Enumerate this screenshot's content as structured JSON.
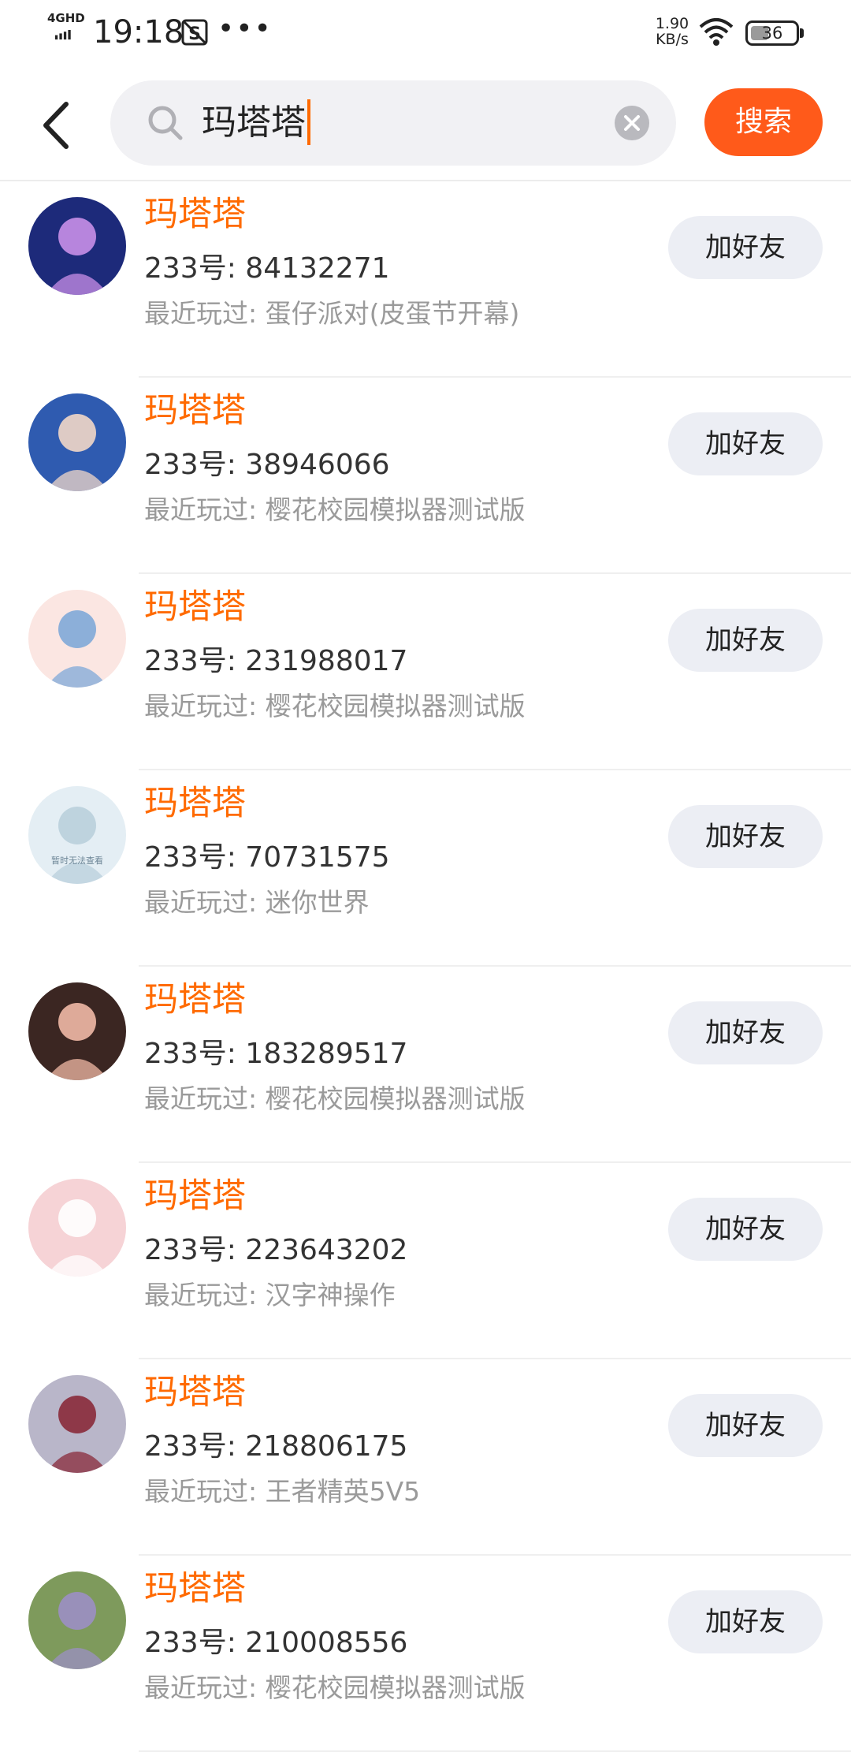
{
  "status_bar": {
    "network": "4GHD",
    "time": "19:18",
    "dots": "•••",
    "speed_value": "1.90",
    "speed_unit": "KB/s",
    "battery": "36"
  },
  "search": {
    "query": "玛塔塔",
    "button_label": "搜索"
  },
  "results": [
    {
      "name": "玛塔塔",
      "uid_prefix": "233号: ",
      "uid": "84132271",
      "recent_prefix": "最近玩过: ",
      "recent": "蛋仔派对(皮蛋节开幕)",
      "button": "加好友",
      "avatar_colors": [
        "#1d2a7a",
        "#c98fe8"
      ]
    },
    {
      "name": "玛塔塔",
      "uid_prefix": "233号: ",
      "uid": "38946066",
      "recent_prefix": "最近玩过: ",
      "recent": "樱花校园模拟器测试版",
      "button": "加好友",
      "avatar_colors": [
        "#2f5bb0",
        "#f2d7c8"
      ]
    },
    {
      "name": "玛塔塔",
      "uid_prefix": "233号: ",
      "uid": "231988017",
      "recent_prefix": "最近玩过: ",
      "recent": "樱花校园模拟器测试版",
      "button": "加好友",
      "avatar_colors": [
        "#fbe6e2",
        "#7fa8d8"
      ]
    },
    {
      "name": "玛塔塔",
      "uid_prefix": "233号: ",
      "uid": "70731575",
      "recent_prefix": "最近玩过: ",
      "recent": "迷你世界",
      "button": "加好友",
      "avatar_colors": [
        "#e4eef4",
        "#b9cfdc"
      ],
      "avatar_caption": "暂时无法查看"
    },
    {
      "name": "玛塔塔",
      "uid_prefix": "233号: ",
      "uid": "183289517",
      "recent_prefix": "最近玩过: ",
      "recent": "樱花校园模拟器测试版",
      "button": "加好友",
      "avatar_colors": [
        "#3b2622",
        "#f1b9a6"
      ]
    },
    {
      "name": "玛塔塔",
      "uid_prefix": "233号: ",
      "uid": "223643202",
      "recent_prefix": "最近玩过: ",
      "recent": "汉字神操作",
      "button": "加好友",
      "avatar_colors": [
        "#f6d3d6",
        "#ffffff"
      ]
    },
    {
      "name": "玛塔塔",
      "uid_prefix": "233号: ",
      "uid": "218806175",
      "recent_prefix": "最近玩过: ",
      "recent": "王者精英5V5",
      "button": "加好友",
      "avatar_colors": [
        "#b9b6c9",
        "#8a2a3a"
      ]
    },
    {
      "name": "玛塔塔",
      "uid_prefix": "233号: ",
      "uid": "210008556",
      "recent_prefix": "最近玩过: ",
      "recent": "樱花校园模拟器测试版",
      "button": "加好友",
      "avatar_colors": [
        "#7e9a5c",
        "#9c8fc4"
      ]
    }
  ]
}
